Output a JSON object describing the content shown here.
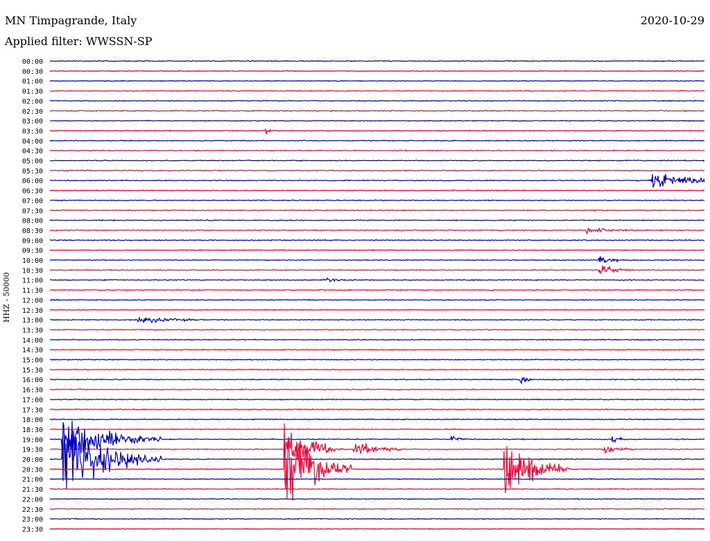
{
  "header": {
    "station": "MN Timpagrande, Italy",
    "date": "2020-10-29",
    "filter": "Applied filter: WWSSN-SP",
    "channel_label": "HHZ - 50000"
  },
  "colors": {
    "even": "#0000cc",
    "odd": "#ff0033"
  },
  "chart_data": {
    "type": "line",
    "title": "MN Timpagrande, Italy",
    "ylabel": "HHZ - 50000",
    "categories": [
      "00:00",
      "00:30",
      "01:00",
      "01:30",
      "02:00",
      "02:30",
      "03:00",
      "03:30",
      "04:00",
      "04:30",
      "05:00",
      "05:30",
      "06:00",
      "06:30",
      "07:00",
      "07:30",
      "08:00",
      "08:30",
      "09:00",
      "09:30",
      "10:00",
      "10:30",
      "11:00",
      "11:30",
      "12:00",
      "12:30",
      "13:00",
      "13:30",
      "14:00",
      "14:30",
      "15:00",
      "15:30",
      "16:00",
      "16:30",
      "17:00",
      "17:30",
      "18:00",
      "18:30",
      "19:00",
      "19:30",
      "20:00",
      "20:30",
      "21:00",
      "21:30",
      "22:00",
      "22:30",
      "23:00",
      "23:30"
    ],
    "events": [
      {
        "row": 12,
        "x": 0.92,
        "amp": 1.0,
        "dur": 0.05
      },
      {
        "row": 7,
        "x": 0.33,
        "amp": 0.25,
        "dur": 0.01
      },
      {
        "row": 17,
        "x": 0.82,
        "amp": 0.3,
        "dur": 0.03
      },
      {
        "row": 20,
        "x": 0.84,
        "amp": 0.25,
        "dur": 0.02
      },
      {
        "row": 21,
        "x": 0.84,
        "amp": 0.4,
        "dur": 0.02
      },
      {
        "row": 22,
        "x": 0.42,
        "amp": 0.2,
        "dur": 0.02
      },
      {
        "row": 26,
        "x": 0.136,
        "amp": 0.4,
        "dur": 0.04
      },
      {
        "row": 32,
        "x": 0.72,
        "amp": 0.3,
        "dur": 0.01
      },
      {
        "row": 38,
        "x": 0.02,
        "amp": 2.2,
        "dur": 0.06
      },
      {
        "row": 38,
        "x": 0.615,
        "amp": 0.35,
        "dur": 0.01
      },
      {
        "row": 38,
        "x": 0.86,
        "amp": 0.35,
        "dur": 0.01
      },
      {
        "row": 39,
        "x": 0.36,
        "amp": 2.4,
        "dur": 0.03
      },
      {
        "row": 39,
        "x": 0.4,
        "amp": 0.3,
        "dur": 0.02
      },
      {
        "row": 39,
        "x": 0.465,
        "amp": 0.8,
        "dur": 0.03
      },
      {
        "row": 39,
        "x": 0.845,
        "amp": 0.4,
        "dur": 0.02
      },
      {
        "row": 40,
        "x": 0.02,
        "amp": 3.5,
        "dur": 0.06
      },
      {
        "row": 41,
        "x": 0.36,
        "amp": 4.2,
        "dur": 0.04
      },
      {
        "row": 41,
        "x": 0.695,
        "amp": 3.0,
        "dur": 0.04
      }
    ]
  }
}
